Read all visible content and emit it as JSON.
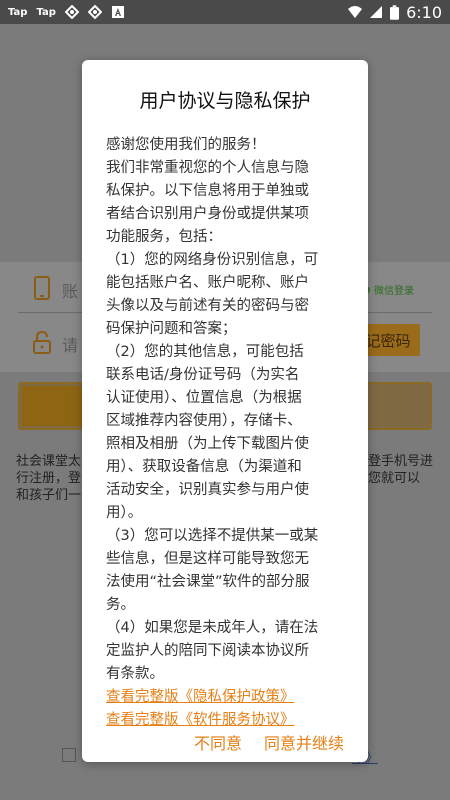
{
  "status_bar": {
    "left_items": [
      "Tap",
      "Tap"
    ],
    "time": "6:10",
    "icons": [
      "tap-icon",
      "sync-icon",
      "sync-icon",
      "accessibility-icon",
      "wifi-icon",
      "signal-icon",
      "battery-icon"
    ]
  },
  "background": {
    "account_placeholder": "账",
    "password_placeholder": "请",
    "wechat_login": "微信登录",
    "forgot_password": "记密码",
    "intro_lines": [
      "社会课堂太",
      "行注册，登",
      "和孩子们一"
    ],
    "intro_right_lines": [
      "登手机号进",
      "您就可以"
    ],
    "agreement_link": "政》"
  },
  "dialog": {
    "title": "用户协议与隐私保护",
    "lines": [
      "感谢您使用我们的服务！",
      "我们非常重视您的个人信息与隐",
      "私保护。以下信息将用于单独或",
      "者结合识别用户身份或提供某项",
      "功能服务，包括：",
      "（1）您的网络身份识别信息，可",
      "能包括账户名、账户昵称、账户",
      "头像以及与前述有关的密码与密",
      "码保护问题和答案；",
      "（2）您的其他信息，可能包括",
      "联系电话/身份证号码（为实名",
      "认证使用）、位置信息（为根据",
      "区域推荐内容使用），存储卡、",
      "照相及相册（为上传下载图片使",
      "用）、获取设备信息（为渠道和",
      "活动安全，识别真实参与用户使",
      "用）。",
      "（3）您可以选择不提供某一或某",
      "些信息，但是这样可能导致您无",
      "法使用“社会课堂”软件的部分服",
      "务。",
      "（4）如果您是未成年人，请在法",
      "定监护人的陪同下阅读本协议所",
      "有条款。"
    ],
    "link_privacy": "查看完整版《隐私保护政策》",
    "link_service": "查看完整版《软件服务协议》",
    "disagree_label": "不同意",
    "agree_label": "同意并继续"
  },
  "colors": {
    "accent": "#e67f14",
    "overlay": "#7b7b7b"
  }
}
